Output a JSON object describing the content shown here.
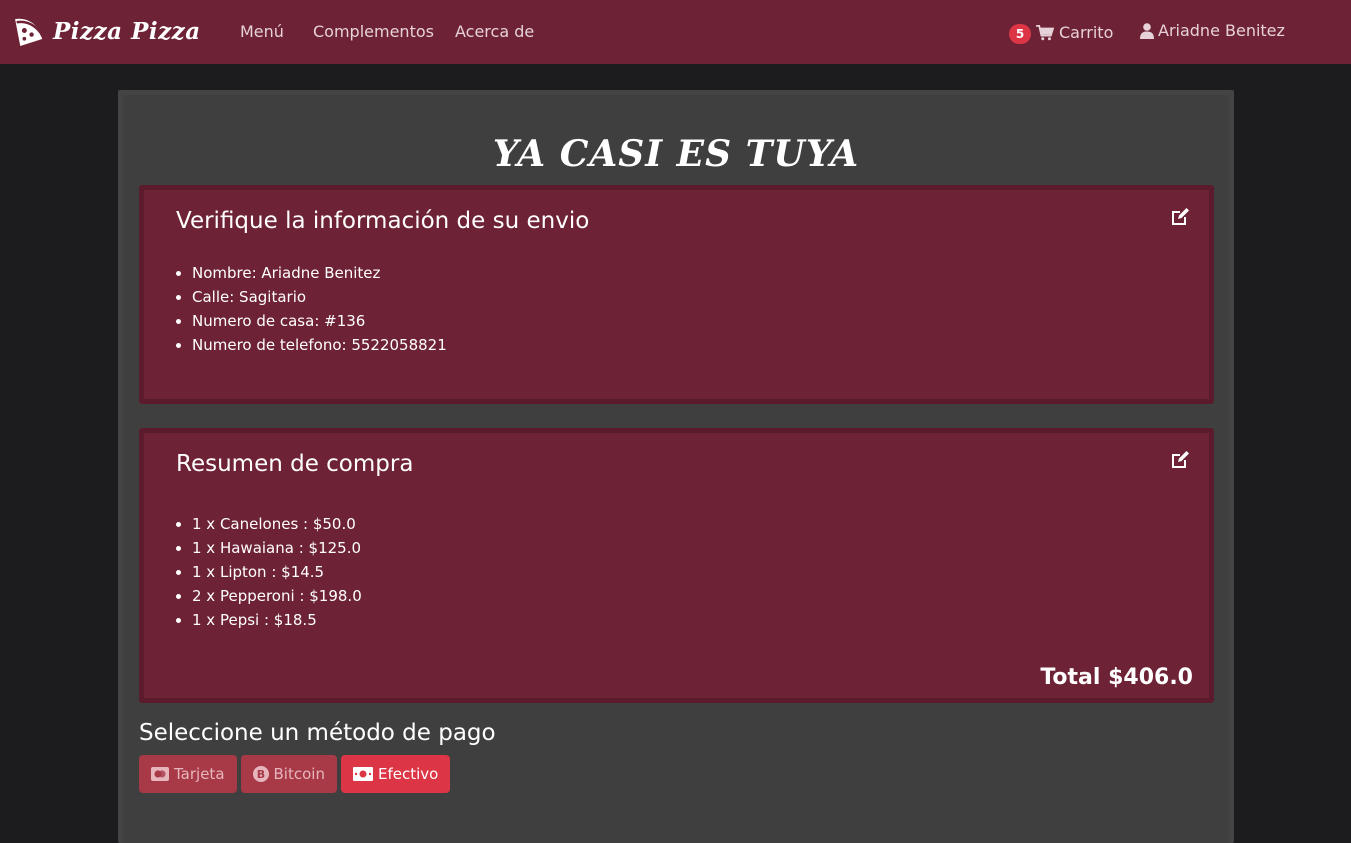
{
  "brand": {
    "name": "Pizza Pizza",
    "icon": "pizza-slice-icon"
  },
  "nav": {
    "links": [
      "Menú",
      "Complementos",
      "Acerca de"
    ],
    "cart_count": "5",
    "cart_label": "Carrito",
    "user_name": "Ariadne Benitez"
  },
  "page": {
    "title": "YA CASI ES TUYA"
  },
  "shipping": {
    "title": "Verifique la información de su envio",
    "items": [
      "Nombre: Ariadne Benitez",
      "Calle: Sagitario",
      "Numero de casa: #136",
      "Numero de telefono: 5522058821"
    ]
  },
  "summary": {
    "title": "Resumen de compra",
    "items": [
      "1 x Canelones : $50.0",
      "1 x Hawaiana : $125.0",
      "1 x Lipton : $14.5",
      "2 x Pepperoni : $198.0",
      "1 x Pepsi : $18.5"
    ],
    "total": "Total $406.0"
  },
  "payment": {
    "title": "Seleccione un método de pago",
    "methods": [
      {
        "label": "Tarjeta",
        "icon": "credit-card-icon",
        "selected": false
      },
      {
        "label": "Bitcoin",
        "icon": "bitcoin-icon",
        "selected": false
      },
      {
        "label": "Efectivo",
        "icon": "cash-icon",
        "selected": true
      }
    ]
  },
  "colors": {
    "navbar": "#6e2236",
    "panel": "#6e2236",
    "card": "#3f3f3f",
    "background": "#1c1c1e",
    "accent": "#dc3545"
  }
}
